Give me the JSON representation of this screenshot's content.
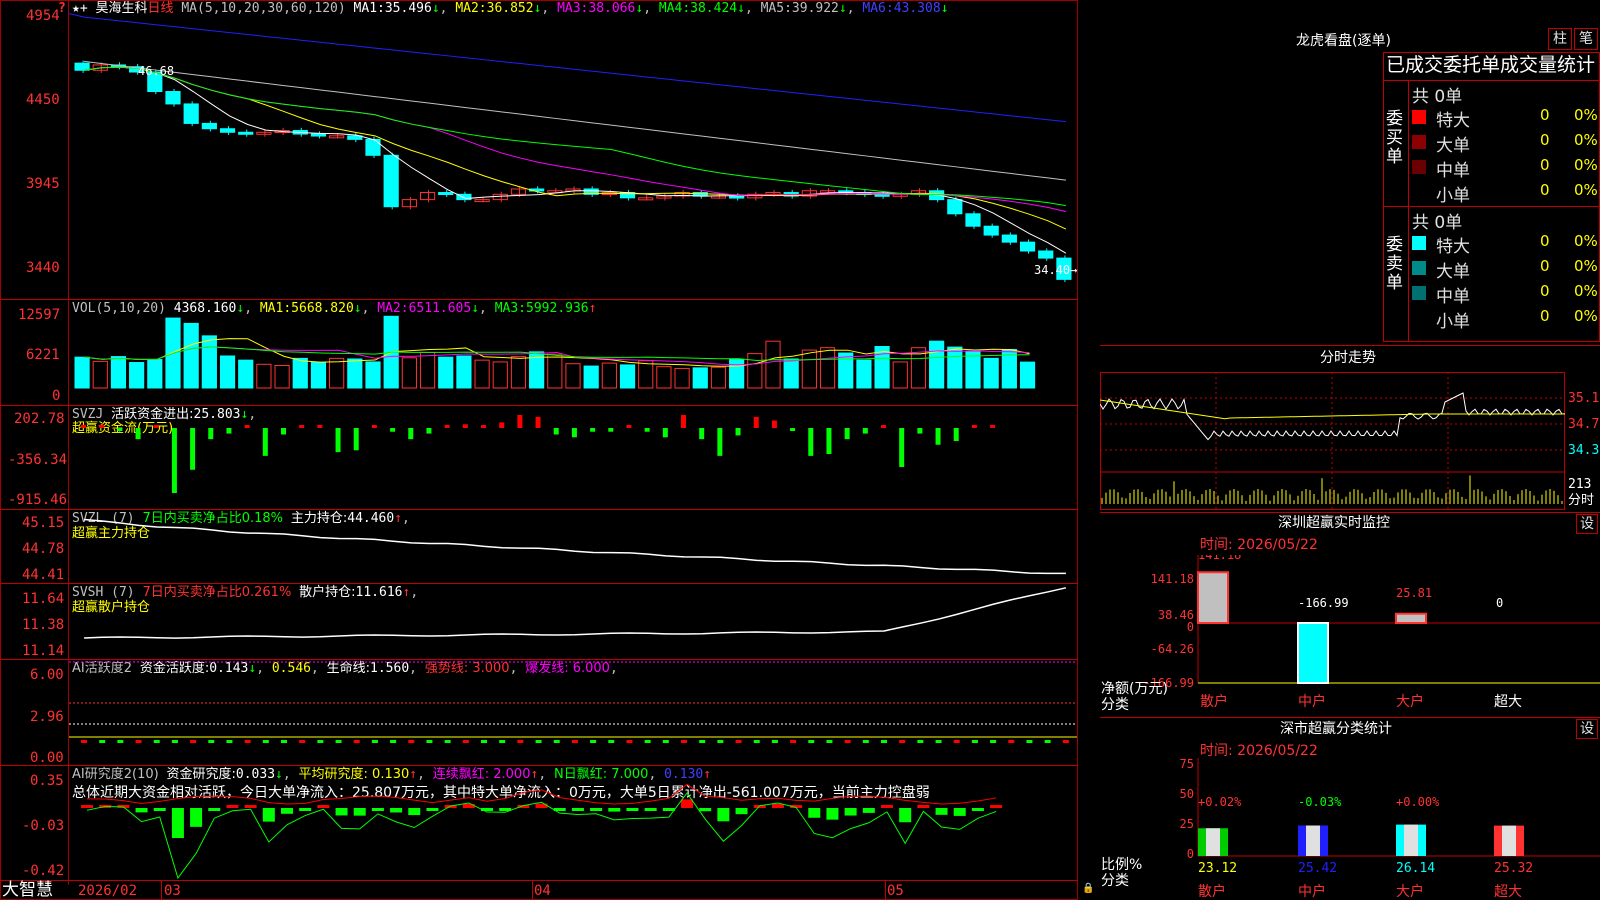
{
  "stock": {
    "name": "昊海生科",
    "period": "日线",
    "ma_params": "MA(5,10,20,30,60,120)",
    "ma1": "35.496",
    "ma2": "36.852",
    "ma3": "38.066",
    "ma4": "38.424",
    "ma5": "39.922",
    "ma6": "43.308",
    "ma_prefix": [
      "MA1:",
      "MA2:",
      "MA3:",
      "MA4:",
      "MA5:",
      "MA6:"
    ],
    "y_ticks": [
      "4954",
      "4450",
      "3945",
      "3440"
    ],
    "high_label": "46.68",
    "last_label": "34.40"
  },
  "vol": {
    "header": "VOL(5,10,20)",
    "value": "4368.160",
    "ma1_label": "MA1:",
    "ma1": "5668.820",
    "ma2_label": "MA2:",
    "ma2": "6511.605",
    "ma3_label": "MA3:",
    "ma3": "5992.936",
    "y_ticks": [
      "12597",
      "6221",
      "0"
    ]
  },
  "svzj": {
    "header": "SVZJ",
    "label": "活跃资金进出:",
    "value": "25.803",
    "sub": "超赢资金流(万元)",
    "y_ticks": [
      "202.78",
      "-356.34",
      "-915.46"
    ]
  },
  "svzl": {
    "header": "SVZL (7)",
    "ratio_label": "7日内买卖净占比0.18%",
    "main_label": "主力持仓:",
    "main_value": "44.460",
    "sub": "超赢主力持仓",
    "y_ticks": [
      "45.15",
      "44.78",
      "44.41"
    ]
  },
  "svsh": {
    "header": "SVSH (7)",
    "ratio_label": "7日内买卖净占比0.261%",
    "label": "散户持仓:",
    "value": "11.616",
    "sub": "超赢散户持仓",
    "y_ticks": [
      "11.64",
      "11.38",
      "11.14"
    ]
  },
  "ai_active": {
    "header": "AI活跃度2",
    "label": "资金活跃度:",
    "v1": "0.143",
    "v2": "0.546",
    "life_label": "生命线:",
    "life": "1.560",
    "strong": "强势线: 3.000",
    "burst": "爆发线: 6.000",
    "y_ticks": [
      "6.00",
      "2.96",
      "0.00"
    ]
  },
  "ai_research": {
    "header": "AI研究度2(10)",
    "label": "资金研究度:",
    "v1": "0.033",
    "avg": "平均研究度: 0.130",
    "streak": "连续飘红: 2.000",
    "nday": "N日飘红: 7.000",
    "last": "0.130",
    "summary": "总体近期大资金相对活跃，今日大单净流入：25.807万元，其中特大单净流入：0万元，大单5日累计净出-561.007万元，当前主力控盘弱",
    "y_ticks": [
      "0.35",
      "-0.03",
      "-0.42"
    ]
  },
  "bottom": {
    "brand": "大智慧",
    "dates": [
      "2026/02",
      "03",
      "04",
      "05"
    ]
  },
  "dragon": {
    "title": "龙虎看盘(逐单)",
    "btn1": "柱",
    "btn2": "笔",
    "subtitle": "已成交委托单成交量统计",
    "buy_total": "共 0单",
    "sell_total": "共 0单",
    "buy_side": "委买单",
    "sell_side": "委卖单",
    "rows": [
      {
        "label": "特大",
        "value": "0",
        "pct": "0%"
      },
      {
        "label": "大单",
        "value": "0",
        "pct": "0%"
      },
      {
        "label": "中单",
        "value": "0",
        "pct": "0%"
      },
      {
        "label": "小单",
        "value": "0",
        "pct": "0%"
      }
    ],
    "buy_colors": [
      "#ff0000",
      "#8b0000",
      "#6a0000",
      ""
    ],
    "sell_colors": [
      "#00ffff",
      "#008b8b",
      "#007070",
      ""
    ]
  },
  "intraday": {
    "title": "分时走势",
    "prices": [
      "35.10",
      "34.72",
      "34.35"
    ],
    "vol_ticks": [
      "213",
      "分时"
    ]
  },
  "monitor": {
    "title": "深圳超赢实时监控",
    "set": "设",
    "time": "时间: 2026/05/22",
    "y_ticks": [
      "141.18",
      "38.46",
      "0",
      "-64.26",
      "-166.99"
    ],
    "unit": "净额(万元)",
    "cat_label": "分类",
    "categories": [
      "散户",
      "中户",
      "大户",
      "超大"
    ],
    "values": [
      "141.18",
      "-166.99",
      "25.81",
      "0"
    ]
  },
  "classify": {
    "title": "深市超赢分类统计",
    "set": "设",
    "time": "时间: 2026/05/22",
    "y_ticks": [
      "75",
      "50",
      "25",
      "0"
    ],
    "ratio_label": "比例%",
    "cat_label": "分类",
    "categories": [
      "散户",
      "中户",
      "大户",
      "超大"
    ],
    "changes": [
      "+0.02%",
      "-0.03%",
      "+0.00%",
      ""
    ],
    "values": [
      "23.12",
      "25.42",
      "26.14",
      "25.32"
    ]
  },
  "chart_data": [
    {
      "type": "candlestick",
      "title": "昊海生科 日线",
      "ylim": [
        34.4,
        49.54
      ],
      "close": [
        46.2,
        46.5,
        46.4,
        46.1,
        45.0,
        44.3,
        43.2,
        42.9,
        42.7,
        42.6,
        42.7,
        42.8,
        42.6,
        42.5,
        42.5,
        42.3,
        41.4,
        38.5,
        38.9,
        39.3,
        39.2,
        38.9,
        38.9,
        39.2,
        39.5,
        39.4,
        39.4,
        39.5,
        39.2,
        39.3,
        39.0,
        39.0,
        39.1,
        39.3,
        39.1,
        39.1,
        39.0,
        39.2,
        39.3,
        39.1,
        39.4,
        39.4,
        39.3,
        39.2,
        39.1,
        39.2,
        39.4,
        38.9,
        38.1,
        37.4,
        36.9,
        36.5,
        36.0,
        35.6,
        34.4
      ],
      "volume": [
        5200,
        4500,
        5300,
        4300,
        4800,
        11800,
        10900,
        8800,
        5400,
        4700,
        4000,
        3800,
        5000,
        4300,
        5000,
        4900,
        4400,
        12100,
        5100,
        6000,
        5200,
        5400,
        4700,
        4400,
        5300,
        6100,
        5700,
        4100,
        3700,
        4200,
        3900,
        4600,
        3600,
        3300,
        3400,
        3500,
        4800,
        5800,
        7900,
        4900,
        6400,
        6800,
        5900,
        4700,
        7000,
        4400,
        6800,
        7900,
        6900,
        6100,
        5000,
        6500,
        4368
      ],
      "flow": [
        20,
        0,
        -10,
        -120,
        0,
        -700,
        -450,
        -120,
        -60,
        0,
        -300,
        -70,
        0,
        0,
        -260,
        -240,
        0,
        -40,
        -120,
        -60,
        0,
        40,
        0,
        60,
        140,
        120,
        -70,
        -100,
        -40,
        -40,
        0,
        -40,
        -100,
        140,
        -120,
        -300,
        -80,
        120,
        80,
        -20,
        -300,
        -280,
        -120,
        -60,
        0,
        -420,
        -60,
        -180,
        -140,
        0,
        25.803
      ],
      "main_hold_range": [
        44.41,
        45.15
      ],
      "retail_hold_range": [
        11.14,
        11.64
      ]
    }
  ]
}
